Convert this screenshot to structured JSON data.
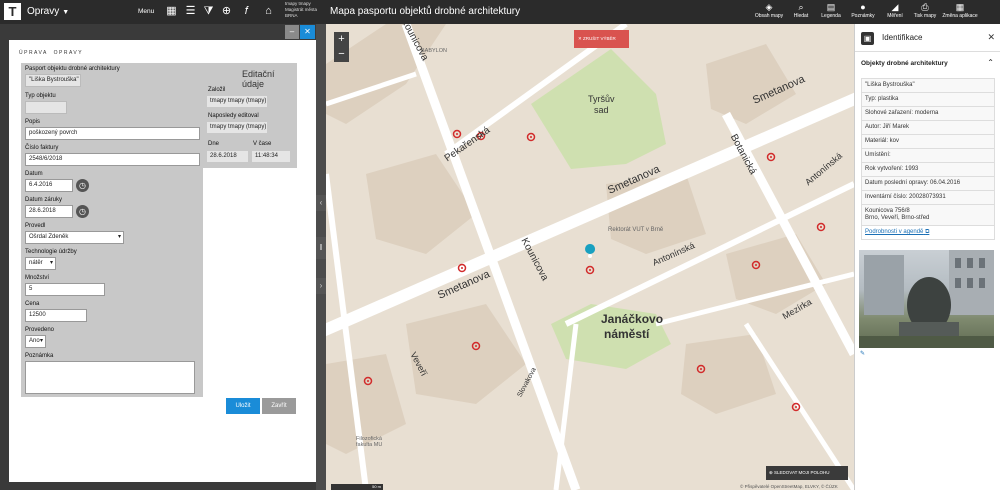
{
  "topbar": {
    "logo": "T",
    "app_title": "Opravy",
    "menu_label": "Menu",
    "user_lines": [
      "tmapy tmapy",
      "Magistrát města",
      "BRNA"
    ],
    "page_title": "Mapa pasportu objektů drobné architektury",
    "tools": [
      "Obsah mapy",
      "Hledat",
      "Legenda",
      "Poznámky",
      "Měření",
      "Tisk mapy",
      "Změna aplikace"
    ]
  },
  "dialog": {
    "header": "ÚPRAVA",
    "header_sub": "OPRAVY",
    "fields": {
      "pasport_label": "Pasport objektu drobné architektury",
      "pasport_value": "\"Liška Bystrouška\"",
      "typ_label": "Typ objektu",
      "popis_label": "Popis",
      "popis_value": "poškozený povrch",
      "faktura_label": "Číslo faktury",
      "faktura_value": "2548/6/2018",
      "datum_label": "Datum",
      "datum_value": "6.4.2016",
      "zaruka_label": "Datum záruky",
      "zaruka_value": "28.6.2018",
      "provedl_label": "Provedl",
      "provedl_value": "Ošrdal Zdeněk",
      "technologie_label": "Technologie údržby",
      "technologie_value": "nátěr",
      "mnozstvi_label": "Množství",
      "mnozstvi_value": "5",
      "cena_label": "Cena",
      "cena_value": "12500",
      "provedeno_label": "Provedeno",
      "provedeno_value": "Ano",
      "poznamka_label": "Poznámka"
    },
    "info": {
      "title": "Editační údaje",
      "zalozil_label": "Založil",
      "zalozil_value": "tmapy tmapy (tmapy)",
      "editoval_label": "Naposledy editoval",
      "editoval_value": "tmapy tmapy (tmapy)",
      "dne_label": "Dne",
      "cas_label": "V čase",
      "dne_value": "28.6.2018",
      "cas_value": "11:48:34"
    },
    "save_label": "Uložit",
    "close_label": "Zavřít"
  },
  "map": {
    "cancel_selection": "ZRUŠIT VÝBĚR",
    "follow_position": "SLEDOVAT MOJI POLOHU",
    "scale": "50 m",
    "attribution": "© Přispěvatelé OpenStreetMap, ELVKY, © ČÚZK",
    "labels": {
      "smetanova1": "Smetanova",
      "smetanova2": "Smetanova",
      "smetanova3": "Smetanova",
      "kounicova": "Kounicova",
      "koblizna": "Kounicova",
      "botanicka": "Botanická",
      "pekarenska": "Pekařenská",
      "janackovo1": "Janáčkovo",
      "janackovo2": "náměstí",
      "tyrsuv1": "Tyršův",
      "tyrsuv2": "sad",
      "antoninska1": "Antonínská",
      "antoninska2": "Antonínská",
      "mezirka": "Mezírka",
      "veveri": "Veveří",
      "slovakova": "Slovakova",
      "bayer": "BABYLON",
      "rektorat": "Rektorát VUT v Brně",
      "filozoficka": "Filozofická fakulta MU"
    }
  },
  "identification": {
    "title": "Identifikace",
    "object_header": "Objekty drobné architektury",
    "rows": [
      "\"Liška Bystrouška\"",
      "Typ: plastika",
      "Slohové zařazení: moderna",
      "Autor: Jiří Marek",
      "Materiál: kov",
      "Umístění:",
      "Rok vytvoření: 1993",
      "Datum poslední opravy: 06.04.2016",
      "Inventární číslo: 20028073931",
      "Kounicova 756/8\nBrno, Veveří, Brno-střed"
    ],
    "link": "Podrobnosti v agendě"
  },
  "colors": {
    "topbar": "#2b2b2b",
    "accent": "#1a8cd8",
    "panel_gray": "#c8c8c8",
    "park_green": "#cfe0b0",
    "cancel_red": "#d9534f",
    "marker_red": "#d22b2b"
  }
}
